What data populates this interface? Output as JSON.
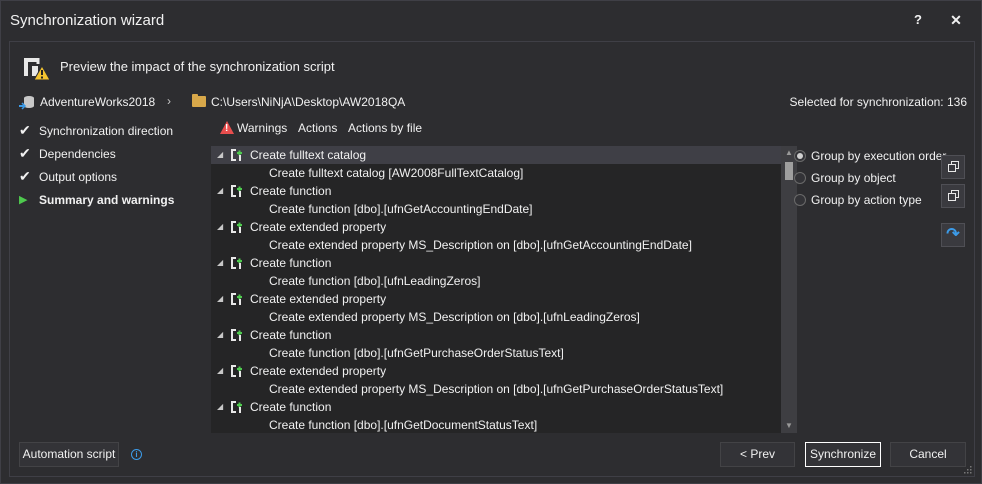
{
  "window": {
    "title": "Synchronization wizard",
    "help_label": "?",
    "close_label": "✕"
  },
  "header": {
    "title": "Preview the impact of the synchronization script"
  },
  "path": {
    "database": "AdventureWorks2018",
    "separator": "›",
    "folder": "C:\\Users\\NiNjA\\Desktop\\AW2018QA",
    "selected_label": "Selected for synchronization: 136"
  },
  "steps": [
    {
      "label": "Synchronization direction",
      "state": "done"
    },
    {
      "label": "Dependencies",
      "state": "done"
    },
    {
      "label": "Output options",
      "state": "done"
    },
    {
      "label": "Summary and warnings",
      "state": "active"
    }
  ],
  "tabs": {
    "warnings": "Warnings",
    "actions": "Actions",
    "actions_by_file": "Actions by file"
  },
  "tree": [
    {
      "type": "parent",
      "text": "Create fulltext catalog",
      "selected": true
    },
    {
      "type": "child",
      "text": "Create fulltext catalog [AW2008FullTextCatalog]"
    },
    {
      "type": "parent",
      "text": "Create function"
    },
    {
      "type": "child",
      "text": "Create function [dbo].[ufnGetAccountingEndDate]"
    },
    {
      "type": "parent",
      "text": "Create extended property"
    },
    {
      "type": "child",
      "text": "Create extended property MS_Description on [dbo].[ufnGetAccountingEndDate]"
    },
    {
      "type": "parent",
      "text": "Create function"
    },
    {
      "type": "child",
      "text": "Create function [dbo].[ufnLeadingZeros]"
    },
    {
      "type": "parent",
      "text": "Create extended property"
    },
    {
      "type": "child",
      "text": "Create extended property MS_Description on [dbo].[ufnLeadingZeros]"
    },
    {
      "type": "parent",
      "text": "Create function"
    },
    {
      "type": "child",
      "text": "Create function [dbo].[ufnGetPurchaseOrderStatusText]"
    },
    {
      "type": "parent",
      "text": "Create extended property"
    },
    {
      "type": "child",
      "text": "Create extended property MS_Description on [dbo].[ufnGetPurchaseOrderStatusText]"
    },
    {
      "type": "parent",
      "text": "Create function"
    },
    {
      "type": "child",
      "text": "Create function [dbo].[ufnGetDocumentStatusText]"
    }
  ],
  "grouping": {
    "by_execution_order": "Group by execution order",
    "by_object": "Group by object",
    "by_action_type": "Group by action type",
    "selected": "by_execution_order"
  },
  "buttons": {
    "automation_script": "Automation script",
    "prev": "< Prev",
    "synchronize": "Synchronize",
    "cancel": "Cancel"
  },
  "colors": {
    "background": "#2d2d30",
    "tree_background": "#252526",
    "accent_blue": "#3c9be8",
    "warning_red": "#e84e4e",
    "active_green": "#4ec94e"
  }
}
